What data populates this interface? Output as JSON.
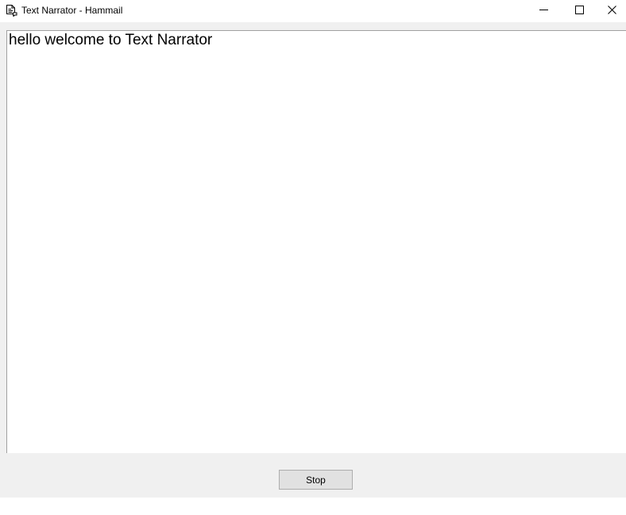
{
  "window": {
    "title": "Text Narrator - Hammail",
    "app_icon": "document-speech-icon",
    "controls": {
      "minimize_icon": "minimize-icon",
      "maximize_icon": "maximize-icon",
      "close_icon": "close-icon"
    }
  },
  "editor": {
    "text": "hello welcome to Text Narrator"
  },
  "actions": {
    "stop_label": "Stop"
  }
}
